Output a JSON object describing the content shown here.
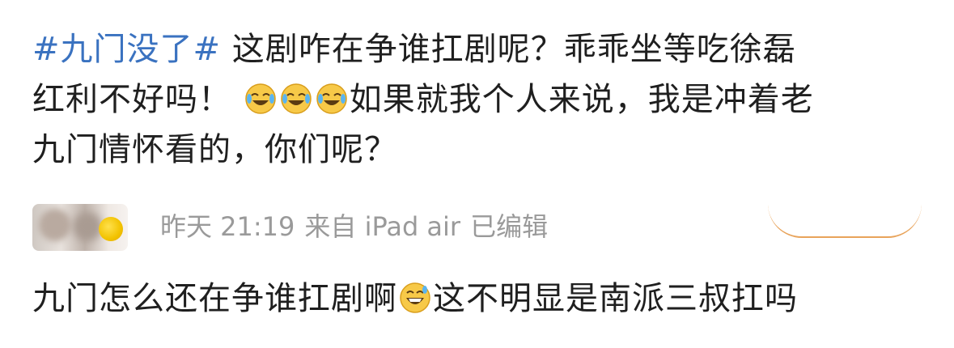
{
  "post": {
    "hashtag": "#九门没了#",
    "line1_rest": " 这剧咋在争谁扛剧呢？乖乖坐等吃徐磊",
    "line2_start": "红利不好吗！",
    "emoji_1": "laugh-cry-emoji",
    "emoji_2": "laugh-cry-emoji",
    "emoji_3": "laugh-cry-emoji",
    "line2_rest": "如果就我个人来说，我是冲着老",
    "line3": "九门情怀看的，你们呢？"
  },
  "meta": {
    "time": "昨天 21:19",
    "source": "来自 iPad air",
    "edited": "已编辑"
  },
  "comment": {
    "text_start": "九门怎么还在争谁扛剧啊",
    "emoji": "grin-sweat-emoji",
    "text_end": "这不明显是南派三叔扛吗"
  },
  "colors": {
    "hashtag": "#3a72c0",
    "text": "#1f1f1f",
    "meta": "#9a9a9a",
    "accent_curve": "#e8a35a"
  }
}
